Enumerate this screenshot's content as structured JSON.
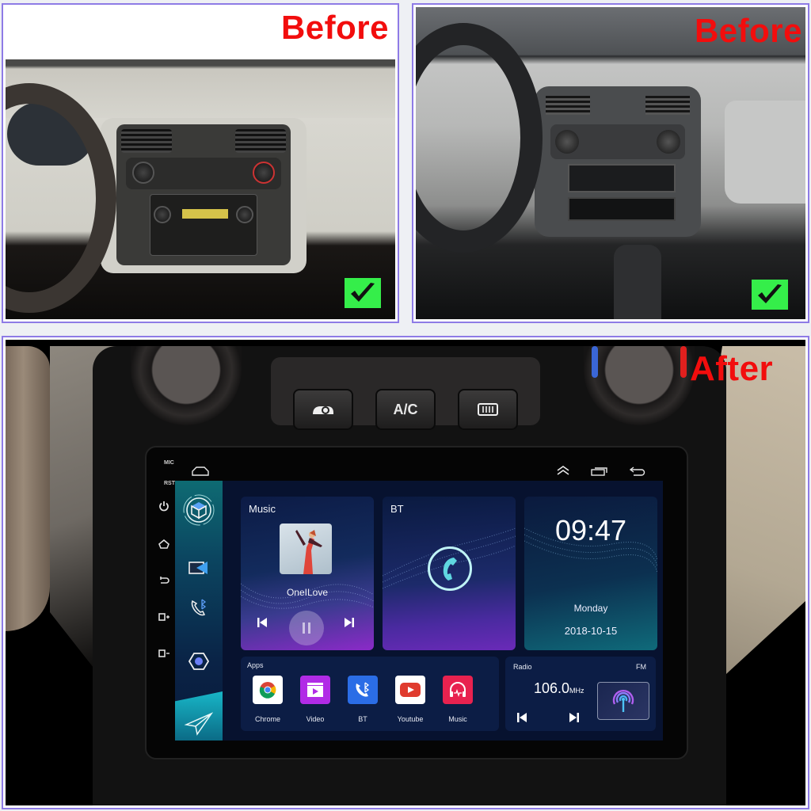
{
  "panels": {
    "before_left": {
      "label": "Before",
      "check_icon": "checkmark-icon"
    },
    "before_right": {
      "label": "Before",
      "check_icon": "checkmark-icon"
    },
    "after": {
      "label": "After"
    }
  },
  "hvac_buttons": [
    "recirculation-icon",
    "A/C",
    "rear-defrost-icon"
  ],
  "head_unit": {
    "side_labels": {
      "mic": "MIC",
      "rst": "RST"
    },
    "hardware_buttons": [
      "power-icon",
      "home-icon",
      "back-icon",
      "volume-up-icon",
      "volume-down-icon"
    ],
    "top_nav": [
      "home-outline-icon",
      "chevron-double-up-icon",
      "recent-apps-icon",
      "back-arrow-icon"
    ]
  },
  "sidebar": {
    "items": [
      "cube-app-icon",
      "video-cast-icon",
      "bluetooth-phone-icon",
      "hexagon-settings-icon",
      "paper-plane-navigation-icon"
    ]
  },
  "music": {
    "title": "Music",
    "song": "OneILove",
    "prev_icon": "skip-previous-icon",
    "pause_icon": "pause-icon",
    "next_icon": "skip-next-icon"
  },
  "bt": {
    "title": "BT"
  },
  "clock": {
    "time": "09:47",
    "day": "Monday",
    "date": "2018-10-15"
  },
  "apps": {
    "title": "Apps",
    "items": [
      {
        "name": "Chrome",
        "color": "#ffffff"
      },
      {
        "name": "Video",
        "color": "#b12be6"
      },
      {
        "name": "BT",
        "color": "#2b6de6"
      },
      {
        "name": "Youtube",
        "color": "#ffffff"
      },
      {
        "name": "Music",
        "color": "#e8224f"
      }
    ]
  },
  "radio": {
    "title": "Radio",
    "band": "FM",
    "frequency": "106.0",
    "unit": "MHz"
  },
  "colors": {
    "label_red": "#f20d0d",
    "check_green": "#35ee4a",
    "screen_bg": "#07122f",
    "accent_teal": "#18b6c7"
  }
}
